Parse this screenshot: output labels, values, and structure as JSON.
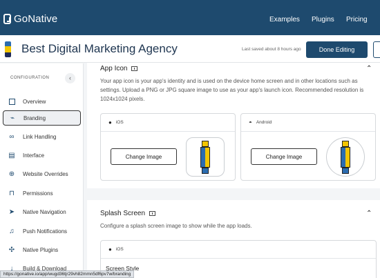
{
  "topnav": {
    "logo_text": "GoNative",
    "links": [
      "Examples",
      "Plugins",
      "Pricing"
    ]
  },
  "app": {
    "title": "Best Digital Marketing Agency",
    "saved_text": "Last saved about 8 hours ago",
    "done_button": "Done Editing"
  },
  "sidebar": {
    "header": "CONFIGURATION",
    "collapse_icon": "chevron-left-icon",
    "items": [
      {
        "label": "Overview",
        "icon": "square-icon"
      },
      {
        "label": "Branding",
        "icon": "brush-icon",
        "active": true
      },
      {
        "label": "Link Handling",
        "icon": "link-icon"
      },
      {
        "label": "Interface",
        "icon": "layout-icon"
      },
      {
        "label": "Website Overrides",
        "icon": "globe-icon"
      },
      {
        "label": "Permissions",
        "icon": "lock-icon"
      },
      {
        "label": "Native Navigation",
        "icon": "navigation-icon"
      },
      {
        "label": "Push Notifications",
        "icon": "bell-icon"
      },
      {
        "label": "Native Plugins",
        "icon": "plugins-icon"
      },
      {
        "label": "Build & Download",
        "icon": "download-icon"
      }
    ]
  },
  "app_icon_section": {
    "title": "App Icon",
    "description": "Your app icon is your app's identity and is used on the device home screen and in other locations such as settings. Upload a PNG or JPG square image to use as your app's launch icon. Recommended resolution is 1024x1024 pixels.",
    "cards": [
      {
        "platform": "iOS",
        "button": "Change Image"
      },
      {
        "platform": "Android",
        "button": "Change Image"
      }
    ]
  },
  "splash_section": {
    "title": "Splash Screen",
    "description": "Configure a splash screen image to show while the app loads.",
    "card_platform": "iOS",
    "style_label": "Screen Style"
  },
  "status_url": "https://gonative.io/app/wugd36tjr29vh82mmn5df6pv7w/branding",
  "colors": {
    "brand": "#1e4a6e",
    "background": "#f3f5f7"
  }
}
